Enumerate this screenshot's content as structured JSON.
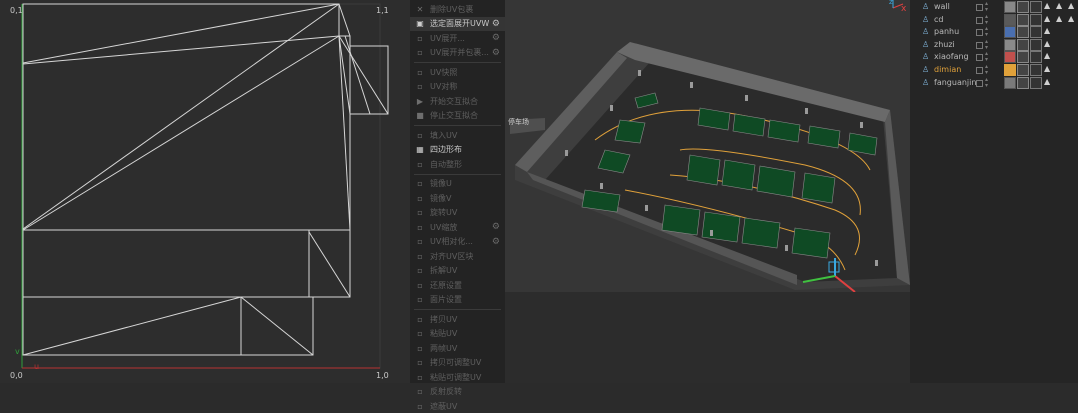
{
  "uv_editor": {
    "corner_top_left": "0,1",
    "corner_top_right": "1,1",
    "corner_bottom_left": "0,0",
    "corner_bottom_right": "1,0",
    "axis_v_label": "v",
    "axis_u_label": "u"
  },
  "uv_menu": [
    {
      "label": "删除UV包裹",
      "icon": "close-icon",
      "enabled": false,
      "gear": false
    },
    {
      "label": "选定面展开UVW",
      "icon": "unwrap-icon",
      "enabled": true,
      "active": true,
      "gear": true
    },
    {
      "label": "UV展开...",
      "icon": "",
      "enabled": false,
      "gear": true
    },
    {
      "label": "UV展开并包裹...",
      "icon": "",
      "enabled": false,
      "gear": true
    },
    {
      "label": "UV快照",
      "icon": "",
      "enabled": false,
      "gear": false
    },
    {
      "label": "UV对称",
      "icon": "",
      "enabled": false,
      "gear": false
    },
    {
      "label": "开始交互拟合",
      "icon": "play-icon",
      "enabled": false,
      "gear": false
    },
    {
      "label": "停止交互拟合",
      "icon": "stop-icon",
      "enabled": false,
      "gear": false
    },
    {
      "label": "填入UV",
      "icon": "",
      "enabled": false,
      "gear": false
    },
    {
      "label": "四边形布",
      "icon": "quad-icon",
      "enabled": true,
      "gear": false
    },
    {
      "label": "自动整形",
      "icon": "",
      "enabled": false,
      "gear": false
    },
    {
      "label": "镜像U",
      "icon": "",
      "enabled": false,
      "gear": false
    },
    {
      "label": "镜像V",
      "icon": "",
      "enabled": false,
      "gear": false
    },
    {
      "label": "旋转UV",
      "icon": "",
      "enabled": false,
      "gear": false
    },
    {
      "label": "UV缩放",
      "icon": "",
      "enabled": false,
      "gear": true
    },
    {
      "label": "UV相对化...",
      "icon": "",
      "enabled": false,
      "gear": true
    },
    {
      "label": "对齐UV区块",
      "icon": "",
      "enabled": false,
      "gear": false
    },
    {
      "label": "拆解UV",
      "icon": "",
      "enabled": false,
      "gear": false
    },
    {
      "label": "还原设置",
      "icon": "",
      "enabled": false,
      "gear": false
    },
    {
      "label": "面片设置",
      "icon": "",
      "enabled": false,
      "gear": false
    },
    {
      "label": "拷贝UV",
      "icon": "",
      "enabled": false,
      "gear": false
    },
    {
      "label": "粘贴UV",
      "icon": "",
      "enabled": false,
      "gear": false
    },
    {
      "label": "两帧UV",
      "icon": "",
      "enabled": false,
      "gear": false
    },
    {
      "label": "拷贝可调整UV",
      "icon": "",
      "enabled": false,
      "gear": false
    },
    {
      "label": "粘贴可调整UV",
      "icon": "",
      "enabled": false,
      "gear": false
    },
    {
      "label": "反射反转",
      "icon": "",
      "enabled": false,
      "gear": false
    },
    {
      "label": "遮蔽UV",
      "icon": "",
      "enabled": false,
      "gear": false
    }
  ],
  "viewport": {
    "axis_x_label": "x",
    "axis_z_label": "z",
    "floor_label": "停车场"
  },
  "outliner": {
    "objects": [
      {
        "name": "wall",
        "selected": false
      },
      {
        "name": "cd",
        "selected": false
      },
      {
        "name": "panhu",
        "selected": false
      },
      {
        "name": "zhuzi",
        "selected": false
      },
      {
        "name": "xiaofang",
        "selected": false
      },
      {
        "name": "dimian",
        "selected": true
      },
      {
        "name": "fanguanjin",
        "selected": false
      }
    ]
  },
  "colors": {
    "uv_line": "#d9d9d9",
    "v_axis": "#2f9e3a",
    "u_axis": "#b83232",
    "parking_bay": "#0f4a24",
    "lane_line": "#e0a13a",
    "selected": "#e0a13a"
  }
}
